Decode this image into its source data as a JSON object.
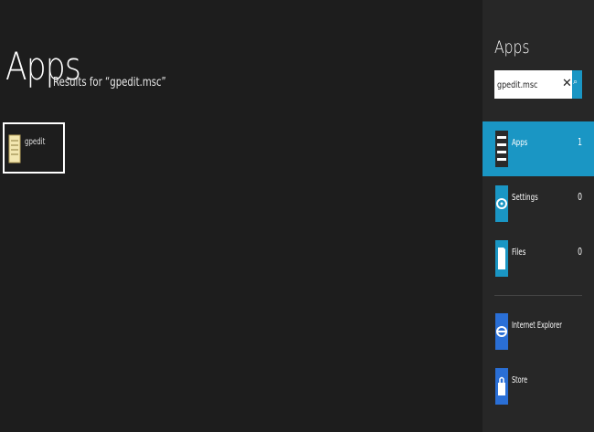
{
  "results": {
    "title": "Apps",
    "subtitle": "Results for “gpedit.msc”",
    "items": [
      {
        "label": "gpedit",
        "icon": "gpedit-icon"
      }
    ]
  },
  "pane": {
    "title": "Apps",
    "search": {
      "value": "gpedit.msc",
      "clear_icon": "close-icon",
      "go_icon": "search-icon"
    },
    "scopes": [
      {
        "label": "Apps",
        "count": "1",
        "icon": "apps-icon",
        "active": true
      },
      {
        "label": "Settings",
        "count": "0",
        "icon": "settings-gear-icon",
        "active": false
      },
      {
        "label": "Files",
        "count": "0",
        "icon": "files-icon",
        "active": false
      }
    ],
    "apps": [
      {
        "label": "Internet Explorer",
        "icon": "internet-explorer-icon"
      },
      {
        "label": "Store",
        "icon": "store-icon"
      }
    ]
  },
  "colors": {
    "background": "#1d1d1d",
    "pane_background": "#272727",
    "accent": "#1a96c4",
    "app_icon": "#2a6fd6"
  }
}
